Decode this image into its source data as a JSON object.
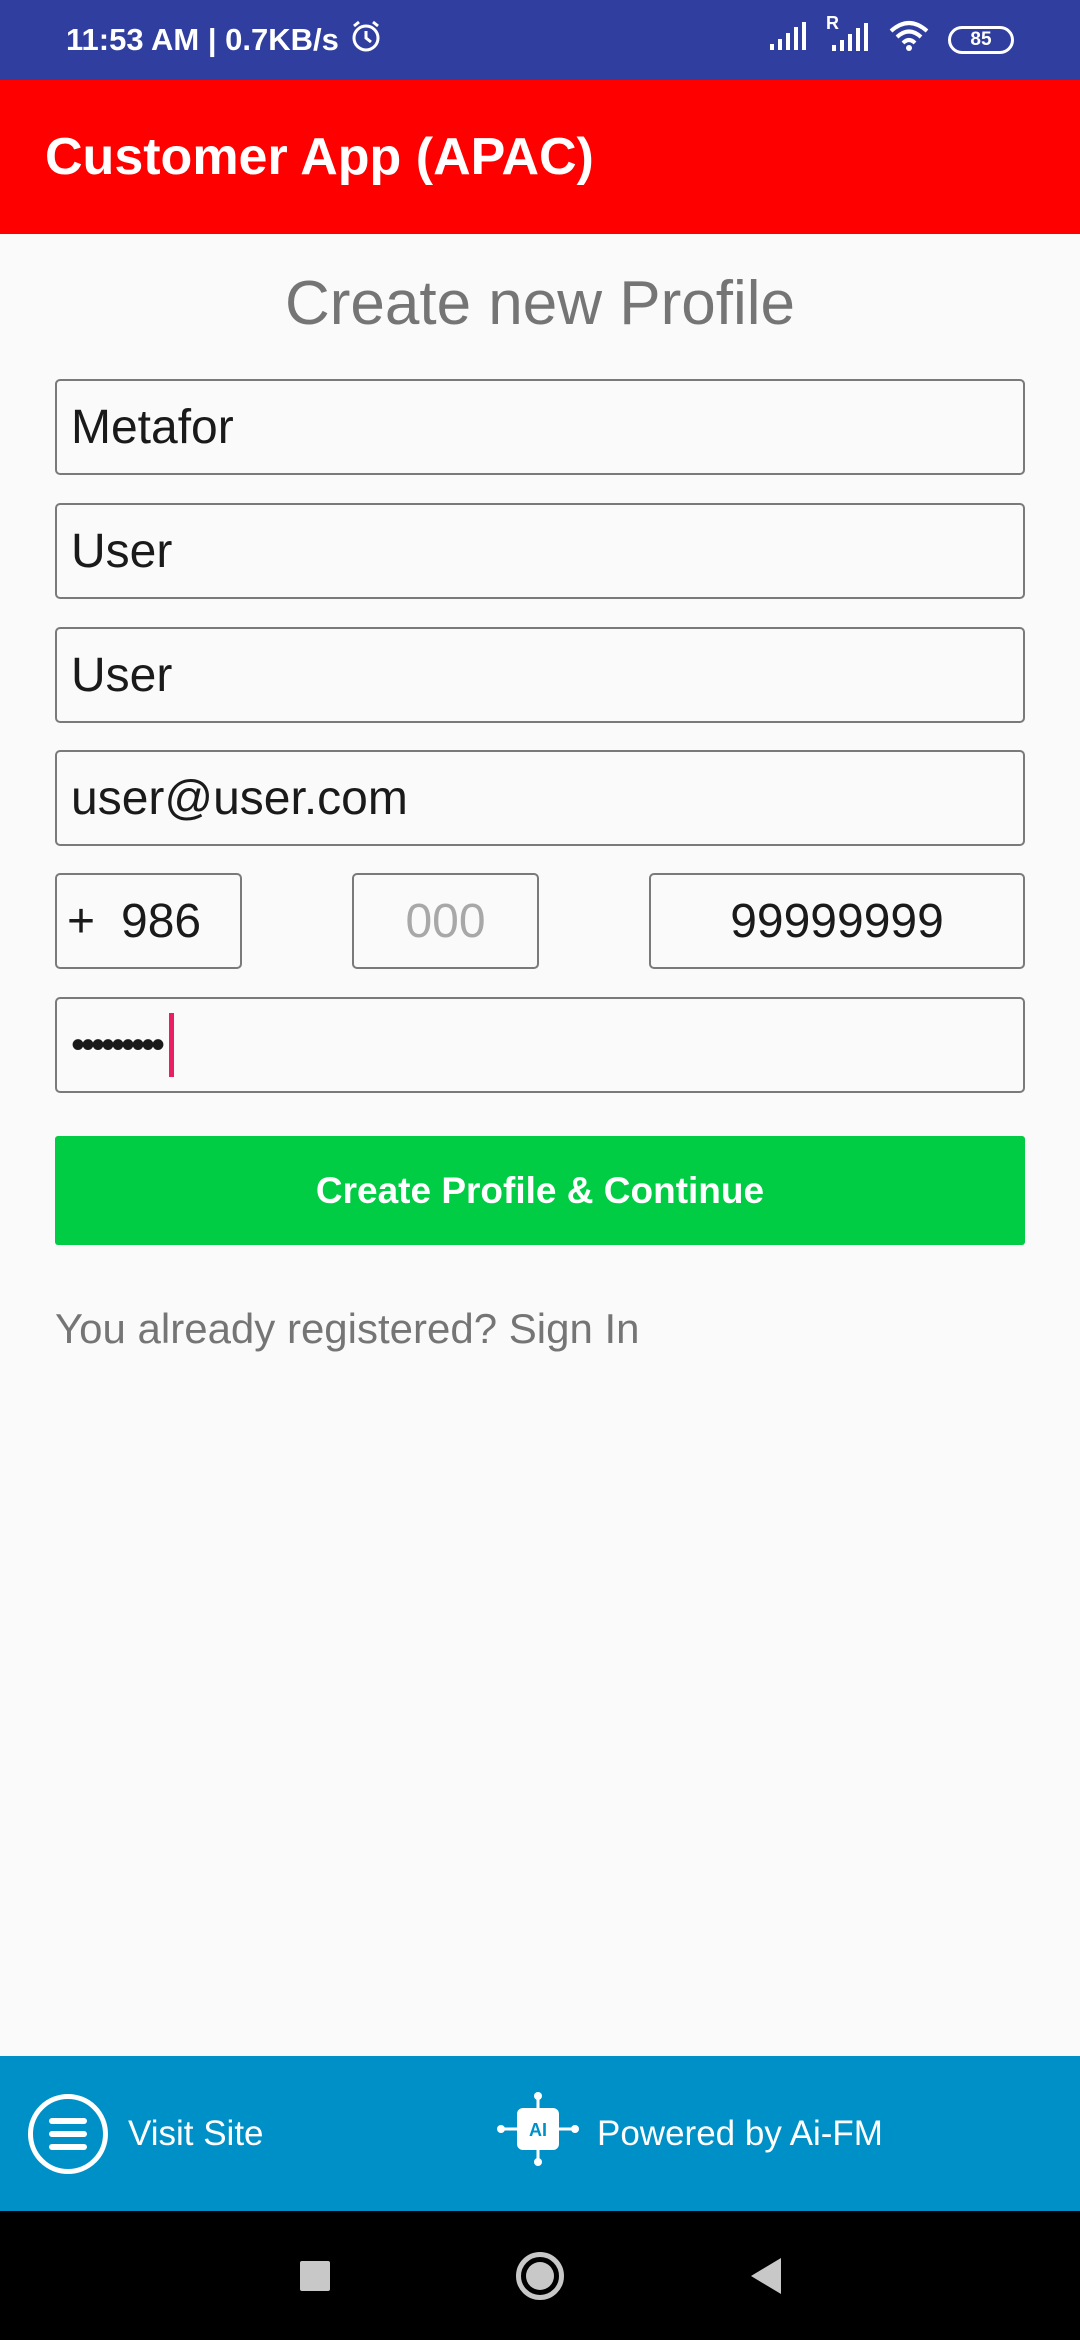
{
  "status_bar": {
    "time_speed": "11:53 AM | 0.7KB/s",
    "battery": "85",
    "roaming": "R",
    "icons": [
      "alarm-icon",
      "signal-icon",
      "signal-roaming-icon",
      "wifi-icon",
      "battery-icon"
    ]
  },
  "app_bar": {
    "title": "Customer App (APAC)"
  },
  "form": {
    "heading": "Create new Profile",
    "first_name": "Metafor",
    "last_name": "User",
    "display_name": "User",
    "email": "user@user.com",
    "phone_plus": "+",
    "country_code": "986",
    "area_code_placeholder": "000",
    "phone_number": "99999999",
    "password_mask": "•••••••••",
    "submit_label": "Create Profile & Continue",
    "signin_text": "You already registered? Sign In"
  },
  "footer": {
    "visit_site": "Visit Site",
    "powered_by": "Powered by Ai-FM",
    "logo_text": "AI"
  },
  "colors": {
    "status_bar": "#303f9f",
    "app_bar": "#ff0000",
    "primary_button": "#00cc44",
    "footer": "#0090c8",
    "caret": "#e91e63"
  }
}
